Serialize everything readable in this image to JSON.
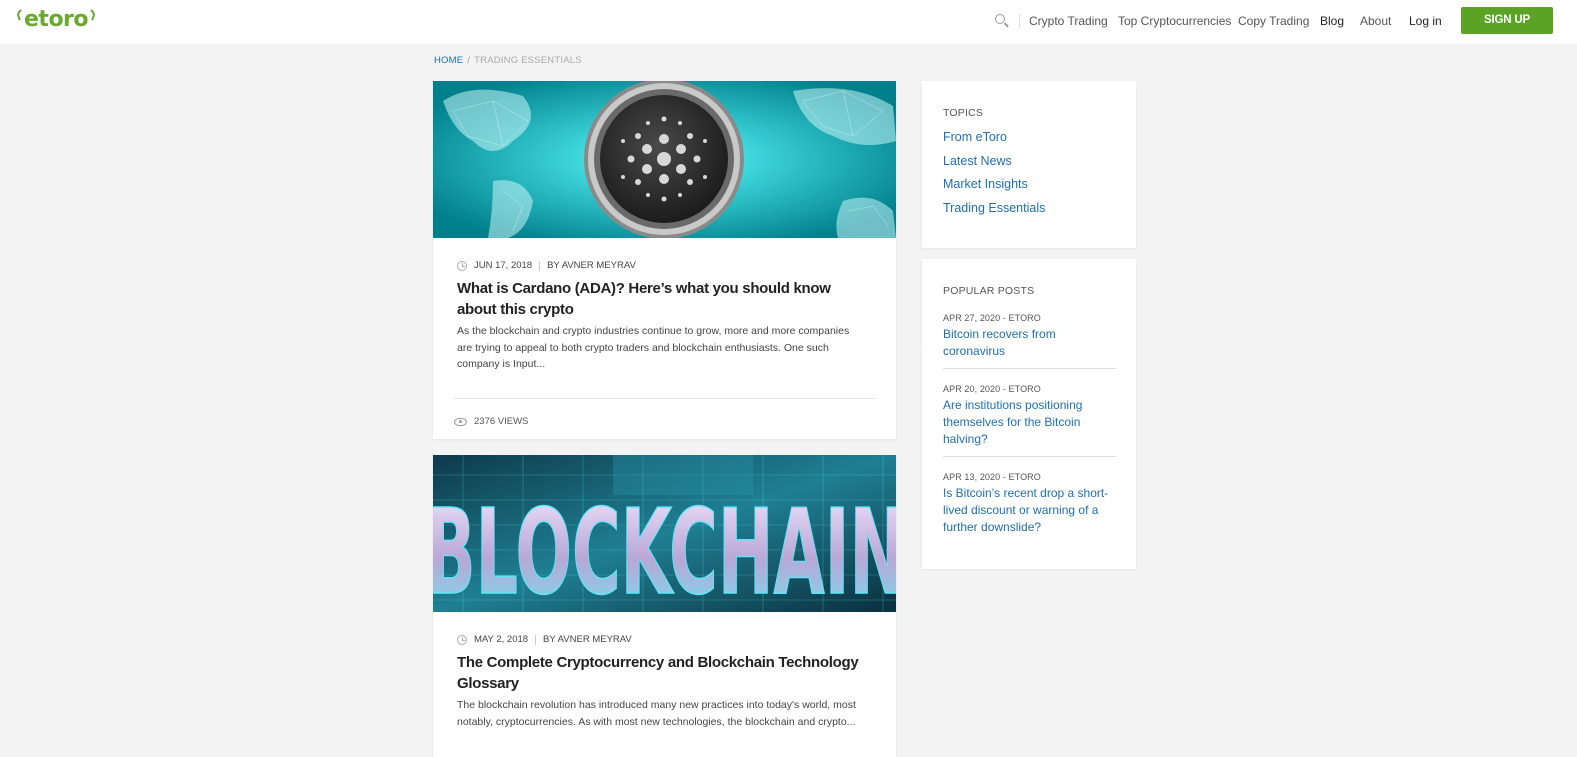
{
  "header": {
    "logo": "etoro",
    "nav": [
      "Crypto Trading",
      "Top Cryptocurrencies",
      "Copy Trading",
      "Blog",
      "About",
      "Log in"
    ],
    "signup": "SIGN UP"
  },
  "breadcrumb": {
    "home": "HOME",
    "separator": "/",
    "current": "TRADING ESSENTIALS"
  },
  "posts": [
    {
      "date": "JUN 17, 2018",
      "author": "BY AVNER MEYRAV",
      "title": "What is Cardano (ADA)? Here’s what you should know about this crypto",
      "excerpt": "As the blockchain and crypto industries continue to grow, more and more companies are trying to appeal to both crypto traders and blockchain enthusiasts. One such company is Input...",
      "views": "2376 VIEWS"
    },
    {
      "date": "MAY 2, 2018",
      "author": "BY AVNER MEYRAV",
      "title": "The Complete Cryptocurrency and Blockchain Technology Glossary",
      "excerpt": "The blockchain revolution has introduced many new practices into today's world, most notably, cryptocurrencies. As with most new technologies, the blockchain and crypto...",
      "image_text": "BLOCKCHAIN"
    }
  ],
  "sidebar": {
    "topics_title": "TOPICS",
    "topics": [
      "From eToro",
      "Latest News",
      "Market Insights",
      "Trading Essentials"
    ],
    "popular_title": "POPULAR POSTS",
    "popular": [
      {
        "meta": "APR 27, 2020 - ETORO",
        "title": "Bitcoin recovers from coronavirus"
      },
      {
        "meta": "APR 20, 2020 - ETORO",
        "title": "Are institutions positioning themselves for the Bitcoin halving?"
      },
      {
        "meta": "APR 13, 2020 - ETORO",
        "title": "Is Bitcoin’s recent drop a short-lived discount or warning of a further downslide?"
      }
    ]
  },
  "colors": {
    "brand_green": "#5ba324",
    "link_blue": "#1f6fb2"
  }
}
